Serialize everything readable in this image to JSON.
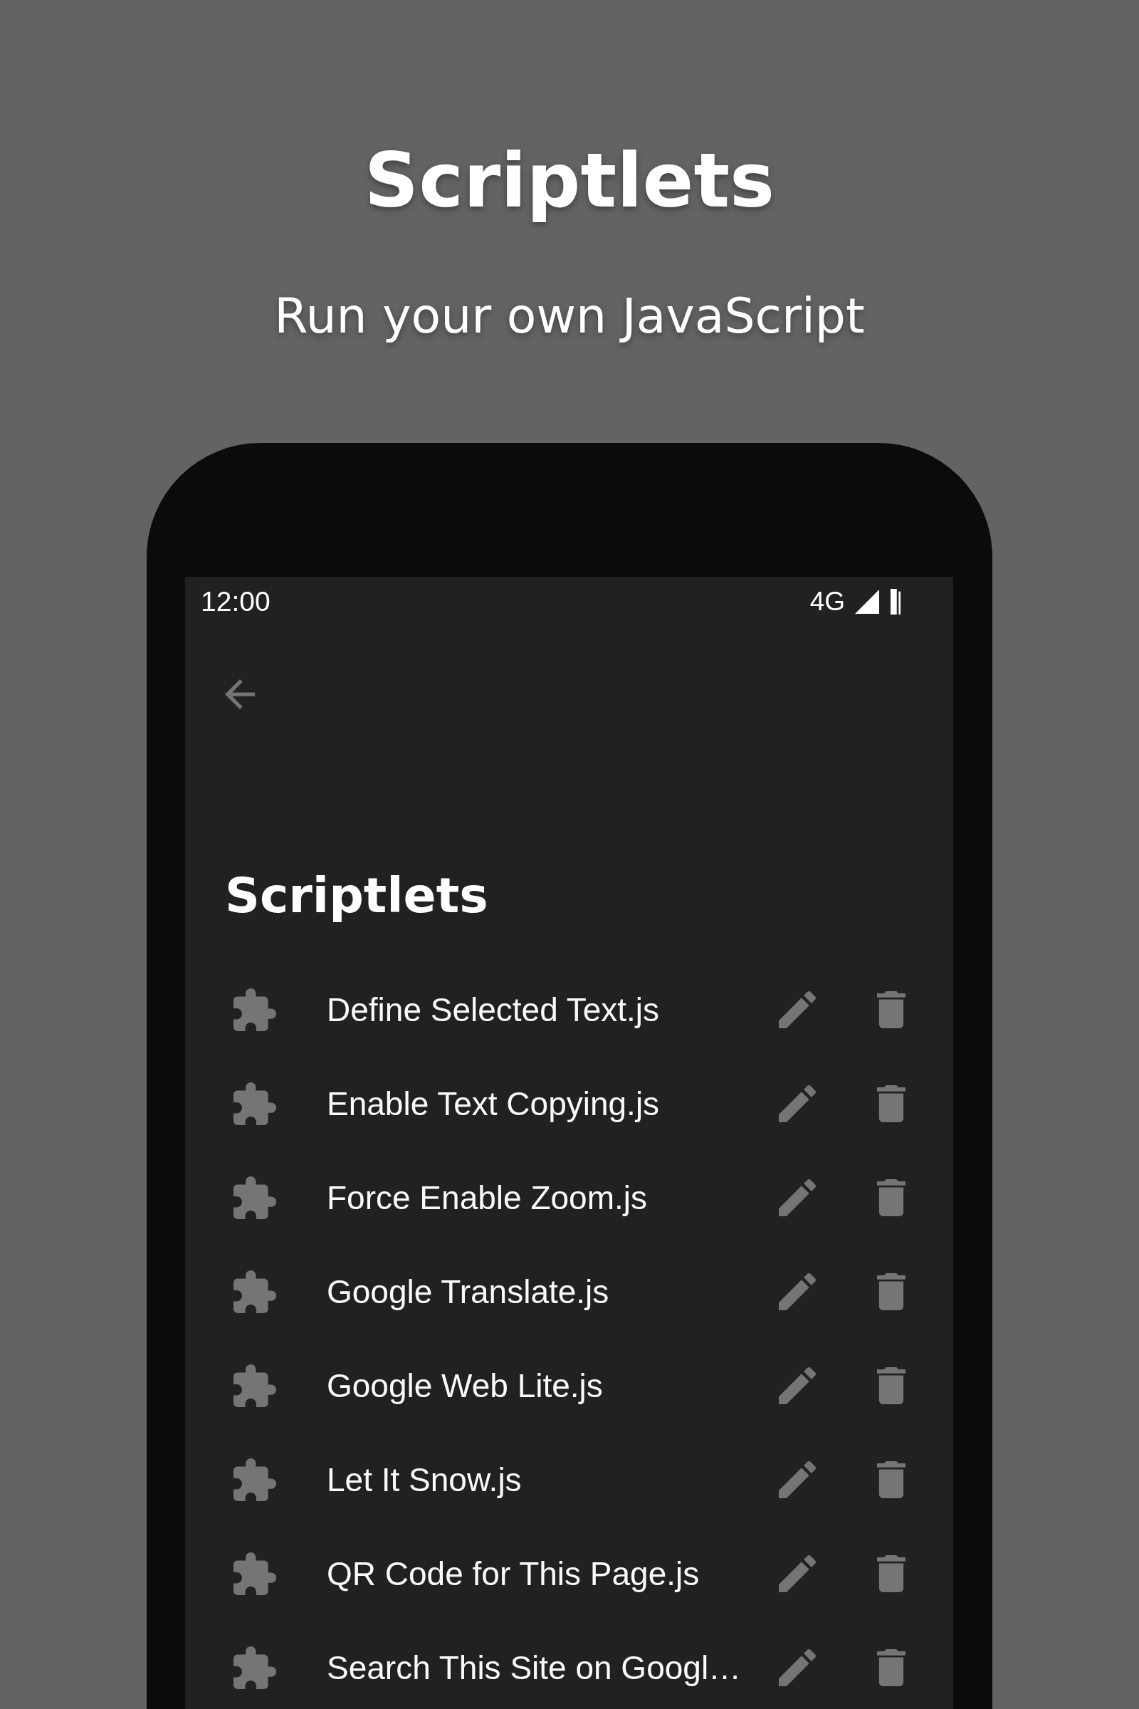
{
  "header": {
    "title": "Scriptlets",
    "subtitle": "Run your own JavaScript"
  },
  "status_bar": {
    "time": "12:00",
    "network": "4G"
  },
  "app_bar": {
    "title": "Scriptlets"
  },
  "scriptlets": [
    {
      "name": "Define Selected Text.js"
    },
    {
      "name": "Enable Text Copying.js"
    },
    {
      "name": "Force Enable Zoom.js"
    },
    {
      "name": "Google Translate.js"
    },
    {
      "name": "Google Web Lite.js"
    },
    {
      "name": "Let It Snow.js"
    },
    {
      "name": "QR Code for This Page.js"
    },
    {
      "name": "Search This Site on Googl…"
    }
  ]
}
